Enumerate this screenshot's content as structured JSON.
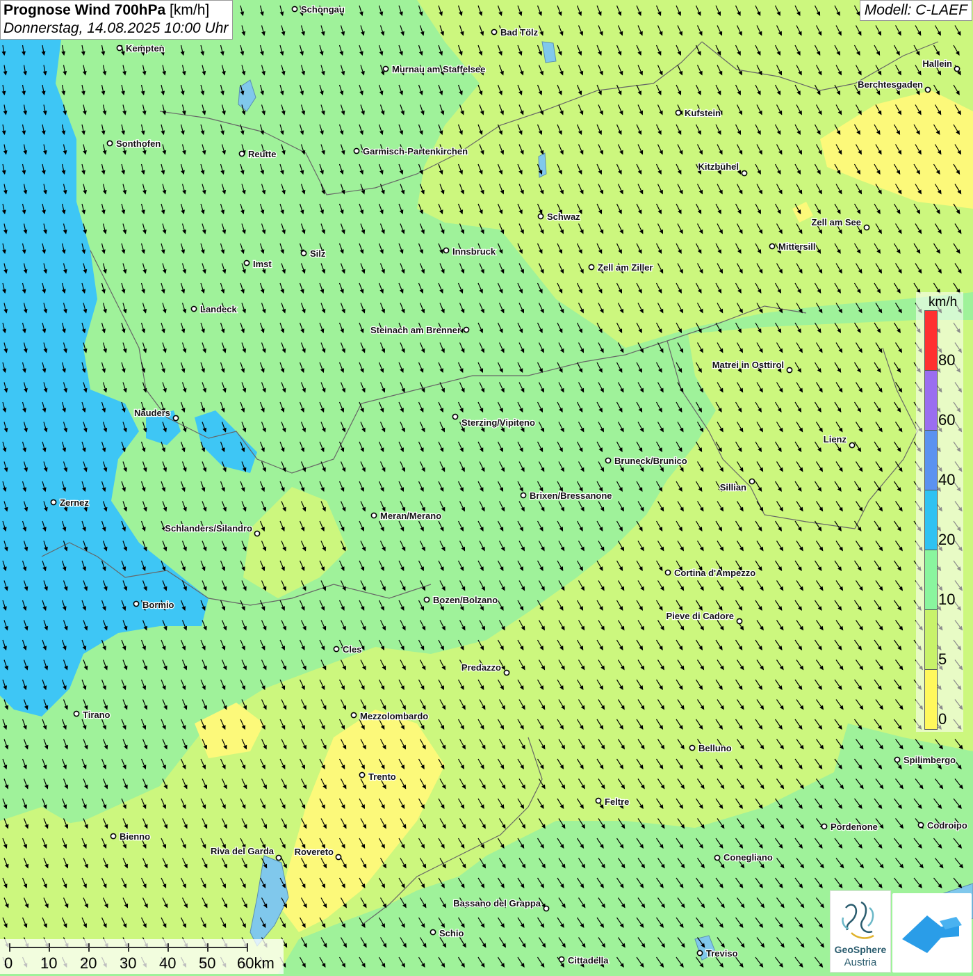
{
  "header": {
    "title_bold": "Prognose Wind 700hPa",
    "title_unit": "[km/h]",
    "datetime": "Donnerstag, 14.08.2025 10:00 Uhr",
    "model": "Modell: C-LAEF"
  },
  "legend": {
    "unit": "km/h",
    "labels": [
      "80",
      "60",
      "40",
      "20",
      "10",
      "5",
      "0"
    ],
    "colors": [
      "#ff3030",
      "#9a6ef0",
      "#5b92f0",
      "#2fc2f2",
      "#8af59e",
      "#c8f26a",
      "#fff85c"
    ]
  },
  "scalebar": {
    "labels": [
      "0",
      "10",
      "20",
      "30",
      "40",
      "50",
      "60km"
    ]
  },
  "logo": {
    "name_line1": "GeoSphere",
    "name_line2": "Austria"
  },
  "cities": [
    {
      "name": "Schongau"
    },
    {
      "name": "Bad Tölz"
    },
    {
      "name": "Kempten"
    },
    {
      "name": "Murnau am Staffelsee"
    },
    {
      "name": "Hallein"
    },
    {
      "name": "Berchtesgaden"
    },
    {
      "name": "Kufstein"
    },
    {
      "name": "Sonthofen"
    },
    {
      "name": "Reutte"
    },
    {
      "name": "Garmisch-Partenkirchen"
    },
    {
      "name": "Kitzbühel"
    },
    {
      "name": "Schwaz"
    },
    {
      "name": "Zell am See"
    },
    {
      "name": "Mittersill"
    },
    {
      "name": "Innsbruck"
    },
    {
      "name": "Silz"
    },
    {
      "name": "Imst"
    },
    {
      "name": "Zell am Ziller"
    },
    {
      "name": "Landeck"
    },
    {
      "name": "Steinach am Brenner"
    },
    {
      "name": "Matrei in Osttirol"
    },
    {
      "name": "Nauders"
    },
    {
      "name": "Sterzing/Vipiteno"
    },
    {
      "name": "Lienz"
    },
    {
      "name": "Bruneck/Brunico"
    },
    {
      "name": "Sillian"
    },
    {
      "name": "Zernez"
    },
    {
      "name": "Brixen/Bressanone"
    },
    {
      "name": "Meran/Merano"
    },
    {
      "name": "Schlanders/Silandro"
    },
    {
      "name": "Cortina d'Ampezzo"
    },
    {
      "name": "Bozen/Bolzano"
    },
    {
      "name": "Bormio"
    },
    {
      "name": "Pieve di Cadore"
    },
    {
      "name": "Cles"
    },
    {
      "name": "Predazzo"
    },
    {
      "name": "Tirano"
    },
    {
      "name": "Mezzolombardo"
    },
    {
      "name": "Belluno"
    },
    {
      "name": "Spilimbergo"
    },
    {
      "name": "Trento"
    },
    {
      "name": "Feltre"
    },
    {
      "name": "Pordenone"
    },
    {
      "name": "Codroipo"
    },
    {
      "name": "Bienno"
    },
    {
      "name": "Riva del Garda"
    },
    {
      "name": "Rovereto"
    },
    {
      "name": "Conegliano"
    },
    {
      "name": "Bassano del Grappa"
    },
    {
      "name": "Schio"
    },
    {
      "name": "Treviso"
    },
    {
      "name": "Cittadella"
    }
  ]
}
